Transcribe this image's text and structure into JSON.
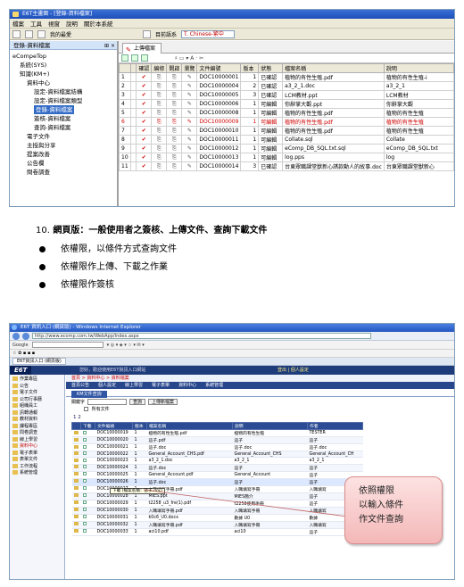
{
  "shot1": {
    "title": "E6T主畫面 - [登錄-資料檔案]",
    "menu": [
      "檔案",
      "工具",
      "視窗",
      "說明",
      "關於本系統"
    ],
    "toolbar_link": "我的最愛",
    "language_label": "目前語系",
    "language_value": "T. Chinese-繁中",
    "left_panel_title": "登錄-資料檔案",
    "tree": [
      {
        "label": "eCompeTop",
        "indent": 0,
        "selected": false
      },
      {
        "label": "系統(SYS)",
        "indent": 1,
        "selected": false
      },
      {
        "label": "知識(KM+)",
        "indent": 1,
        "selected": false
      },
      {
        "label": "資料中心",
        "indent": 2,
        "selected": false
      },
      {
        "label": "設定-資料檔案結構",
        "indent": 3,
        "selected": false
      },
      {
        "label": "設定-資料檔案類型",
        "indent": 3,
        "selected": false
      },
      {
        "label": "登錄-資料檔案",
        "indent": 3,
        "selected": true
      },
      {
        "label": "簽核-資料檔案",
        "indent": 3,
        "selected": false
      },
      {
        "label": "查詢-資料檔案",
        "indent": 3,
        "selected": false
      },
      {
        "label": "電子文件",
        "indent": 2,
        "selected": false
      },
      {
        "label": "主授與分享",
        "indent": 2,
        "selected": false
      },
      {
        "label": "提案改善",
        "indent": 2,
        "selected": false
      },
      {
        "label": "公告欄",
        "indent": 2,
        "selected": false
      },
      {
        "label": "問卷調查",
        "indent": 2,
        "selected": false
      }
    ],
    "tab_label": "上傳檔案",
    "columns": [
      "",
      "",
      "確認",
      "編修",
      "開啟",
      "瀏覽",
      "文件編號",
      "版本",
      "狀態",
      "檔案名稱",
      "說明"
    ],
    "rows": [
      {
        "id": "DOC10000001",
        "ver": "1",
        "status": "已確認",
        "file": "植物的有性生殖.pdf",
        "desc": "植物的有性生殖-i",
        "red": false
      },
      {
        "id": "DOC10000004",
        "ver": "2",
        "status": "已確認",
        "file": "a3_2_1.doc",
        "desc": "a3_2_1",
        "red": false
      },
      {
        "id": "DOC10000005",
        "ver": "3",
        "status": "已確認",
        "file": "LCM教材.ppt",
        "desc": "LCM教材",
        "red": false
      },
      {
        "id": "DOC10000006",
        "ver": "1",
        "status": "可編輯",
        "file": "你辭掌大觀.ppt",
        "desc": "你辭掌大觀",
        "red": false
      },
      {
        "id": "DOC10000008",
        "ver": "1",
        "status": "可編輯",
        "file": "植物的有性生殖.pdf",
        "desc": "植物的有性生殖",
        "red": false
      },
      {
        "id": "DOC10000009",
        "ver": "1",
        "status": "可編輯",
        "file": "植物的有性生殖.pdf",
        "desc": "植物的有性生殖",
        "red": true
      },
      {
        "id": "DOC10000010",
        "ver": "1",
        "status": "可編輯",
        "file": "植物的有性生殖.pdf",
        "desc": "植物的有性生殖",
        "red": false
      },
      {
        "id": "DOC10000011",
        "ver": "1",
        "status": "可編輯",
        "file": "Collate.sql",
        "desc": "Collate",
        "red": false
      },
      {
        "id": "DOC10000012",
        "ver": "1",
        "status": "可編輯",
        "file": "eComp_DB_SQL.txt.sql",
        "desc": "eComp_DB_SQL.txt",
        "red": false
      },
      {
        "id": "DOC10000013",
        "ver": "1",
        "status": "可編輯",
        "file": "log.pps",
        "desc": "log",
        "red": false
      },
      {
        "id": "DOC10000014",
        "ver": "3",
        "status": "已確認",
        "file": "台東眾職課堂獸新心誘款動人的故事.doc",
        "desc": "台東眾職課堂獸新心",
        "red": false
      }
    ]
  },
  "instructions": {
    "number": "10.",
    "title": "網頁版：一般使用者之簽核、上傳文件、查詢下載文件",
    "bullets": [
      "依權限，以條件方式查詢文件",
      "依權限作上傳、下載之作業",
      "依權限作簽核"
    ]
  },
  "shot2": {
    "window_title": "E6T 資訊入口 (網頁版) - Windows Internet Explorer",
    "address": "http://www.ecomp.com.tw/WebApp/Index.aspx",
    "google_label": "Google",
    "tab_label": "E6T資訊入口 (網頁版)",
    "logo": "E6T",
    "brand_note": "您好，歡迎使用E6T資訊入口網站",
    "brand_right": "登出 | 個人設定",
    "sidebar": [
      {
        "label": "作業專區",
        "current": false
      },
      {
        "label": "公告",
        "current": false
      },
      {
        "label": "電子文件",
        "current": false
      },
      {
        "label": "公司行事曆",
        "current": false
      },
      {
        "label": "組織員工",
        "current": false
      },
      {
        "label": "訊轉通報",
        "current": false
      },
      {
        "label": "教材資料",
        "current": false
      },
      {
        "label": "課程專區",
        "current": false
      },
      {
        "label": "問卷調查",
        "current": false
      },
      {
        "label": "線上學習",
        "current": false
      },
      {
        "label": "資料中心",
        "current": true
      },
      {
        "label": "電子表單",
        "current": false
      },
      {
        "label": "表單文件",
        "current": false
      },
      {
        "label": "工作流程",
        "current": false
      },
      {
        "label": "系統管理",
        "current": false
      }
    ],
    "crumb": "首頁 > 資料中心 > 資料檔案",
    "topnav": [
      "首頁公告",
      "個人設定",
      "線上學習",
      "電子表單",
      "資料中心",
      "系統管理"
    ],
    "grid_tab": "KM文件查詢",
    "query_label": "關鍵字",
    "query_button": "查詢",
    "upload_button": "上傳新檔案",
    "option_label": "所有文件",
    "pager": "1 2",
    "columns": [
      "",
      "下載",
      "文件編號",
      "版本",
      "檔案名稱",
      "說明",
      "作者"
    ],
    "rows": [
      {
        "id": "DOC10000019",
        "ver": "1",
        "file": "植物的有性生殖.pdf",
        "desc": "植物的有性生殖",
        "author": "TESTER"
      },
      {
        "id": "DOC10000020",
        "ver": "1",
        "file": "這子.pdf",
        "desc": "這子",
        "author": "這子"
      },
      {
        "id": "DOC10000021",
        "ver": "1",
        "file": "這子.doc",
        "desc": "這子.doc",
        "author": "這子.doc"
      },
      {
        "id": "DOC10000022",
        "ver": "1",
        "file": "General_Account_CHS.pdf",
        "desc": "General_Account_CHS",
        "author": "General_Account_CH"
      },
      {
        "id": "DOC10000023",
        "ver": "1",
        "file": "a3_2_1.doc",
        "desc": "a3_2_1",
        "author": "a3_2_1"
      },
      {
        "id": "DOC10000024",
        "ver": "1",
        "file": "這子.doc",
        "desc": "這子",
        "author": "這子"
      },
      {
        "id": "DOC10000025",
        "ver": "1",
        "file": "General_Account.pdf",
        "desc": "General_Account",
        "author": "這子"
      },
      {
        "id": "DOC10000026",
        "ver": "1",
        "file": "這子.doc",
        "desc": "這子",
        "author": "這子"
      },
      {
        "id": "DOC10000027",
        "ver": "1",
        "file": "入職填寫手冊.pdf",
        "desc": "入職填寫手冊",
        "author": "入職填寫"
      },
      {
        "id": "DOC10000028",
        "ver": "1",
        "file": "MIES.ppt",
        "desc": "MIES簡介",
        "author": "這子"
      },
      {
        "id": "DOC10000029",
        "ver": "1",
        "file": "t2258_u3_fre(1).pdf",
        "desc": "t2258使用手冊",
        "author": "這子"
      },
      {
        "id": "DOC10000030",
        "ver": "1",
        "file": "入職填寫手冊.pdf",
        "desc": "入職填寫手冊",
        "author": "入職填寫"
      },
      {
        "id": "DOC10000031",
        "ver": "1",
        "file": "k0c6_U0.docx",
        "desc": "數據 U0",
        "author": "數據"
      },
      {
        "id": "DOC10000032",
        "ver": "1",
        "file": "入職填寫手冊.pdf",
        "desc": "入職填寫手冊",
        "author": "入職填寫"
      },
      {
        "id": "DOC10000033",
        "ver": "1",
        "file": "aci10.pdf",
        "desc": "aci10",
        "author": "這子"
      }
    ],
    "tooltip": "下載 (檔案名稱：這子.doc)",
    "callout": [
      "依照權限",
      "以輸入條件",
      "作文件查詢"
    ]
  }
}
